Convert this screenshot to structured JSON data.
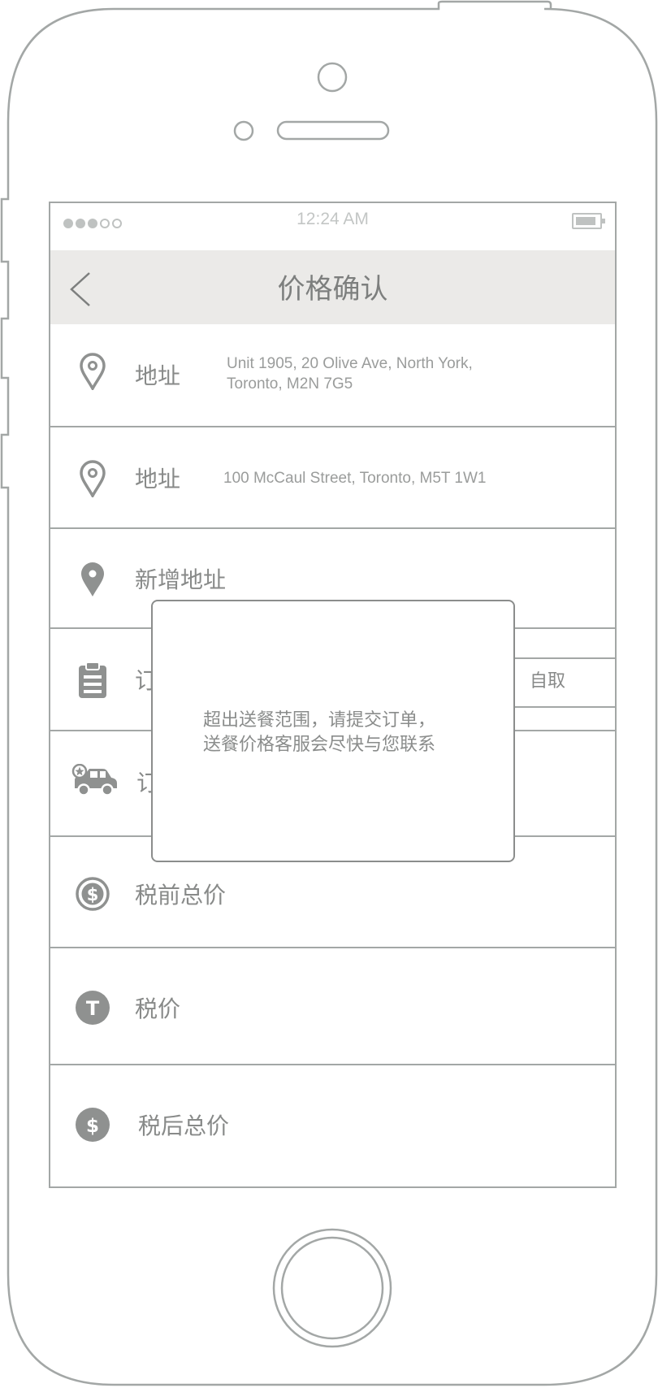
{
  "status_bar": {
    "time": "12:24 AM"
  },
  "navbar": {
    "title": "价格确认"
  },
  "address_rows": [
    {
      "label": "地址",
      "line1": "Unit 1905, 20 Olive Ave, North York,",
      "line2": "Toronto, M2N 7G5"
    },
    {
      "label": "地址",
      "line1": "100 McCaul Street, Toronto, M5T 1W1"
    }
  ],
  "add_address": {
    "label": "新增地址"
  },
  "order_row": {
    "label_partial": "订",
    "pickup_button": "自取"
  },
  "delivery_row": {
    "label_partial": "订"
  },
  "price_rows": [
    {
      "label": "税前总价",
      "icon": "dollar-circle-outline-icon"
    },
    {
      "label": "税价",
      "icon": "tax-t-circle-icon"
    },
    {
      "label": "税后总价",
      "icon": "dollar-circle-filled-icon"
    }
  ],
  "dialog": {
    "message_line1": "超出送餐范围，请提交订单，",
    "message_line2": "送餐价格客服会尽快与您联系"
  },
  "colors": {
    "outline": "#a3a7a6",
    "text": "#888a89",
    "nav_bg": "#ebeae8"
  }
}
